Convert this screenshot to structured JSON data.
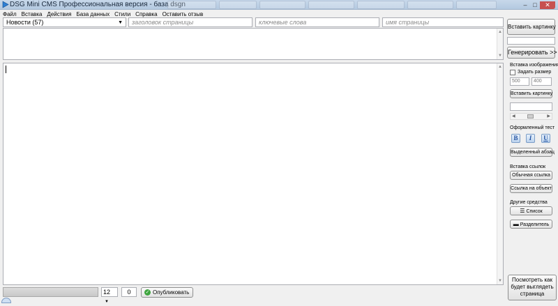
{
  "window": {
    "title": "DSG Mini CMS Профессиональная версия - база dsgn"
  },
  "menu": [
    "Файл",
    "Вставка",
    "Действия",
    "База данных",
    "Стили",
    "Справка",
    "Оставить отзыв"
  ],
  "fields": {
    "category": "Новости (57)",
    "title_placeholder": "заголовок страницы",
    "keywords_placeholder": "ключевые слова",
    "pagename_placeholder": "имя страницы"
  },
  "bottom": {
    "font_size": "12",
    "counter": "0",
    "publish": "Опубликовать",
    "progress": 0
  },
  "sidebar": {
    "insert_image": "Вставить картинку",
    "generate": "Генерировать >>",
    "image_section": "Вставка изображения",
    "set_size": "Задать размер",
    "width": "500",
    "height": "400",
    "insert_image_2": "Вставить картинку",
    "format_section": "Оформленный тест",
    "bold": "B",
    "italic": "I",
    "underline": "U",
    "highlight": "Выделенный абзац",
    "links_section": "Вставка ссылок",
    "plain_link": "Обычная ссылка",
    "object_link": "Ссылка на объект",
    "other_section": "Другие средства",
    "list": "Список",
    "divider": "Разделитель",
    "preview": "Посмотреть как будет выглядеть страница"
  },
  "icons": {
    "app": "dsg-app-icon",
    "checkmark": "checkmark-icon",
    "list": "list-icon",
    "divider": "divider-icon"
  },
  "colors": {
    "titlebar": "#c7d8ea",
    "close_button": "#c75050",
    "accent_blue": "#1f4f9f",
    "publish_check": "#3fa53f"
  }
}
